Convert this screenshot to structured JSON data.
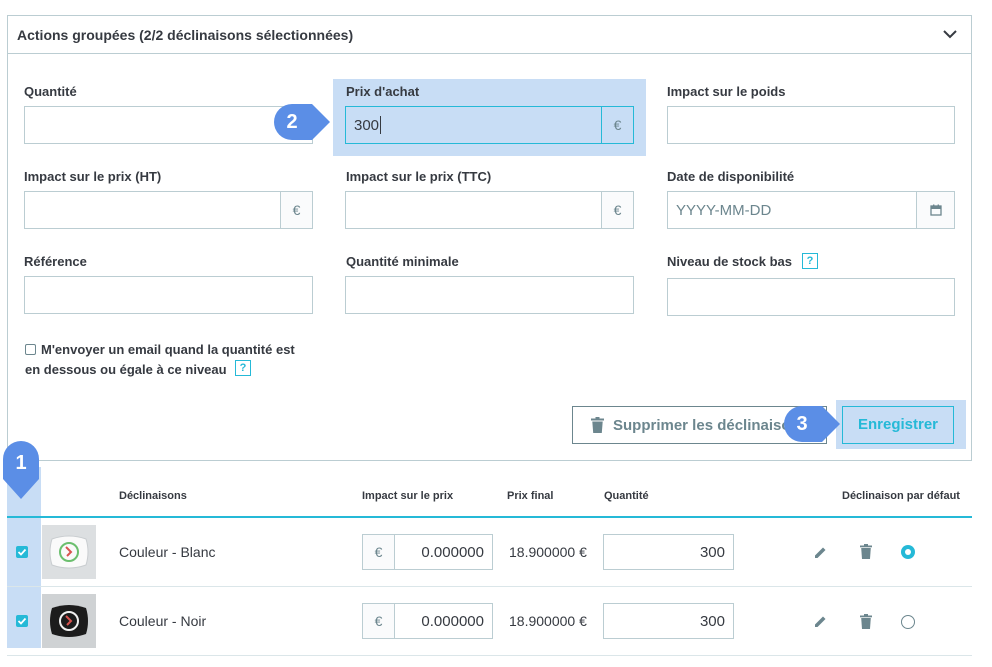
{
  "panel": {
    "title": "Actions groupées (2/2 déclinaisons sélectionnées)"
  },
  "form": {
    "quantite_label": "Quantité",
    "quantite_value": "",
    "prix_achat_label": "Prix d'achat",
    "prix_achat_value": "300",
    "impact_poids_label": "Impact sur le poids",
    "impact_prix_ht_label": "Impact sur le prix (HT)",
    "impact_prix_ttc_label": "Impact sur le prix (TTC)",
    "date_dispo_label": "Date de disponibilité",
    "date_dispo_placeholder": "YYYY-MM-DD",
    "reference_label": "Référence",
    "quantite_min_label": "Quantité minimale",
    "stock_bas_label": "Niveau de stock bas",
    "currency": "€",
    "help": "?",
    "email_checkbox_line1": "M'envoyer un email quand la quantité est",
    "email_checkbox_line2": "en dessous ou égale à ce niveau"
  },
  "buttons": {
    "delete_label": "Supprimer les déclinaisons",
    "save_label": "Enregistrer"
  },
  "markers": {
    "m1": "1",
    "m2": "2",
    "m3": "3"
  },
  "table": {
    "headers": {
      "declinaisons": "Déclinaisons",
      "impact_prix": "Impact sur le prix",
      "prix_final": "Prix final",
      "quantite": "Quantité",
      "par_defaut": "Déclinaison par défaut"
    },
    "rows": [
      {
        "name": "Couleur - Blanc",
        "currency": "€",
        "impact": "0.000000",
        "final_price": "18.900000 €",
        "quantity": "300",
        "is_default": true,
        "checked": true
      },
      {
        "name": "Couleur - Noir",
        "currency": "€",
        "impact": "0.000000",
        "final_price": "18.900000 €",
        "quantity": "300",
        "is_default": false,
        "checked": true
      }
    ]
  },
  "colors": {
    "accent": "#25b9d7",
    "highlight": "#c8ddf5",
    "marker": "#5b8ee6",
    "border": "#bbcdd2",
    "text": "#363a41",
    "muted": "#6c868e"
  }
}
